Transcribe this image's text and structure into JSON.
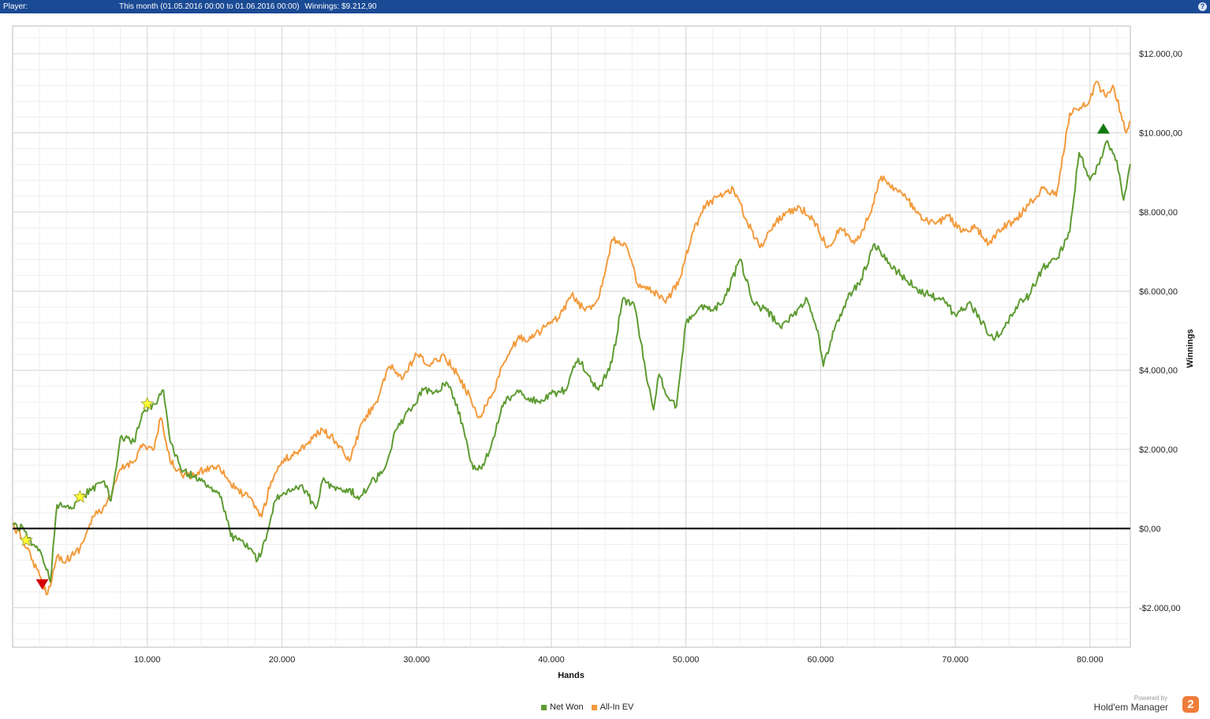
{
  "header": {
    "player_label": "Player:",
    "period": "This month (01.05.2016 00:00 to 01.06.2016 00:00)",
    "winnings_label": "Winnings:",
    "winnings_value": "$9.212,90",
    "help_icon": "question-icon"
  },
  "legend": {
    "net_won": "Net Won",
    "allin_ev": "All-In EV"
  },
  "brand": {
    "powered_by": "Powered by",
    "name": "Hold'em Manager",
    "logo_text": "2"
  },
  "chart_data": {
    "type": "line",
    "xlabel": "Hands",
    "ylabel": "Winnings",
    "xlim": [
      0,
      83000
    ],
    "ylim": [
      -3000,
      12700
    ],
    "x_ticks": [
      10000,
      20000,
      30000,
      40000,
      50000,
      60000,
      70000,
      80000
    ],
    "x_tick_labels": [
      "10.000",
      "20.000",
      "30.000",
      "40.000",
      "50.000",
      "60.000",
      "70.000",
      "80.000"
    ],
    "y_ticks": [
      -2000,
      0,
      2000,
      4000,
      6000,
      8000,
      10000,
      12000
    ],
    "y_tick_labels": [
      "-$2.000,00",
      "$0,00",
      "$2.000,00",
      "$4.000,00",
      "$6.000,00",
      "$8.000,00",
      "$10.000,00",
      "$12.000,00"
    ],
    "grid": true,
    "legend_position": "bottom-center",
    "colors": {
      "net_won": "#5e9b32",
      "allin_ev": "#f39a3c",
      "zero_line": "#000000"
    },
    "series": [
      {
        "name": "Net Won",
        "x": [
          0,
          800,
          1500,
          2200,
          2800,
          3300,
          4200,
          5000,
          5900,
          6800,
          7300,
          8000,
          9000,
          9800,
          10500,
          11200,
          11700,
          12500,
          13500,
          14500,
          15500,
          16200,
          17000,
          17600,
          18200,
          18800,
          19500,
          20500,
          21500,
          22500,
          23000,
          23800,
          24800,
          25800,
          26500,
          27500,
          28500,
          29500,
          30500,
          31200,
          32200,
          32800,
          33500,
          34200,
          35000,
          35700,
          36500,
          37500,
          38300,
          39000,
          40000,
          41000,
          42000,
          42700,
          43500,
          44500,
          45300,
          46200,
          47000,
          47600,
          48000,
          48700,
          49300,
          50000,
          51000,
          52000,
          53000,
          54000,
          55000,
          56000,
          57000,
          58000,
          59000,
          59800,
          60200,
          61000,
          62000,
          63000,
          64000,
          65000,
          66000,
          67000,
          68000,
          69000,
          70000,
          71000,
          72000,
          72800,
          73500,
          74500,
          75500,
          76500,
          77500,
          78500,
          79200,
          80000,
          80700,
          81300,
          82000,
          82500,
          83000
        ],
        "y": [
          100,
          0,
          -400,
          -700,
          -1350,
          600,
          500,
          750,
          1000,
          1200,
          700,
          2300,
          2200,
          3000,
          3150,
          3500,
          2200,
          1500,
          1300,
          1100,
          800,
          -200,
          -300,
          -500,
          -800,
          -300,
          700,
          1000,
          1100,
          500,
          1200,
          1050,
          1000,
          800,
          1100,
          1450,
          2500,
          3000,
          3500,
          3400,
          3700,
          3300,
          2500,
          1500,
          1600,
          2300,
          3200,
          3500,
          3300,
          3200,
          3400,
          3500,
          4300,
          3900,
          3500,
          4200,
          5800,
          5600,
          4000,
          3000,
          3900,
          3300,
          3100,
          5200,
          5600,
          5500,
          5900,
          6800,
          5700,
          5500,
          5100,
          5400,
          5800,
          5000,
          4100,
          5000,
          5800,
          6300,
          7200,
          6700,
          6400,
          6100,
          5900,
          5800,
          5400,
          5700,
          5200,
          4800,
          5000,
          5600,
          5900,
          6600,
          6800,
          7500,
          9500,
          8800,
          9200,
          9800,
          9300,
          8300,
          9212.9
        ]
      },
      {
        "name": "All-In EV",
        "x": [
          0,
          800,
          1500,
          2200,
          2600,
          3300,
          4000,
          5000,
          6000,
          6700,
          7300,
          8000,
          9000,
          9500,
          10500,
          11000,
          11700,
          12500,
          13300,
          14300,
          15300,
          16500,
          17500,
          18500,
          19200,
          20000,
          21000,
          22000,
          23000,
          24000,
          25000,
          26000,
          27000,
          28000,
          29000,
          30000,
          31000,
          32000,
          33000,
          34000,
          34600,
          35500,
          36500,
          37500,
          38500,
          39500,
          40500,
          41500,
          42500,
          43500,
          44500,
          45500,
          46500,
          47500,
          48500,
          49500,
          50500,
          51500,
          52500,
          53500,
          54500,
          55500,
          56500,
          57500,
          58500,
          59500,
          60500,
          61500,
          62500,
          63500,
          64500,
          65500,
          66500,
          67500,
          68500,
          69500,
          70500,
          71500,
          72500,
          73500,
          74500,
          75500,
          76500,
          77500,
          78500,
          79000,
          79800,
          80500,
          81200,
          81700,
          82300,
          82700,
          83000
        ],
        "y": [
          100,
          -300,
          -800,
          -1400,
          -1650,
          -700,
          -800,
          -500,
          300,
          500,
          800,
          1500,
          1700,
          2100,
          2000,
          2800,
          1700,
          1400,
          1300,
          1500,
          1600,
          1000,
          800,
          300,
          1200,
          1700,
          1900,
          2200,
          2500,
          2200,
          1700,
          2700,
          3200,
          4100,
          3800,
          4400,
          4100,
          4400,
          3900,
          3300,
          2800,
          3300,
          4200,
          4800,
          4800,
          5100,
          5300,
          5900,
          5500,
          5800,
          7300,
          7200,
          6100,
          6000,
          5700,
          6300,
          7500,
          8200,
          8400,
          8600,
          7800,
          7100,
          7700,
          8000,
          8100,
          7800,
          7100,
          7600,
          7200,
          7800,
          8900,
          8600,
          8300,
          7800,
          7700,
          7900,
          7500,
          7600,
          7200,
          7600,
          7800,
          8200,
          8600,
          8400,
          10500,
          10600,
          10700,
          11300,
          10900,
          11200,
          10500,
          10000,
          10300
        ]
      }
    ],
    "markers": [
      {
        "type": "star",
        "series": "Net Won",
        "x": 1000,
        "y": -300,
        "color": "#ffff33"
      },
      {
        "type": "star",
        "series": "Net Won",
        "x": 5000,
        "y": 800,
        "color": "#ffff33"
      },
      {
        "type": "star",
        "series": "Net Won",
        "x": 10000,
        "y": 3150,
        "color": "#ffff33"
      },
      {
        "type": "low",
        "series": "Net Won",
        "x": 2200,
        "y": -1400,
        "color": "#d40000"
      },
      {
        "type": "high",
        "series": "Net Won",
        "x": 81000,
        "y": 10100,
        "color": "#127a12"
      }
    ]
  }
}
